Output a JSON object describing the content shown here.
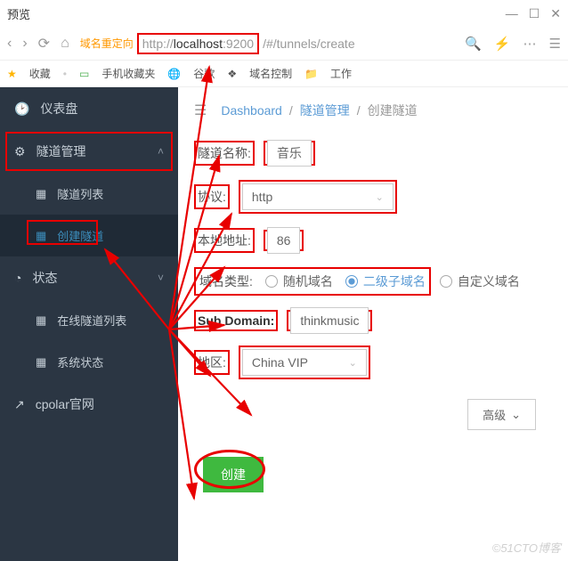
{
  "window": {
    "title": "预览"
  },
  "browser": {
    "redirect_label": "域名重定向",
    "url_proto": "http://",
    "url_domain": "localhost",
    "url_port": ":9200",
    "url_suffix": "/#/tunnels/create"
  },
  "bookmarks": {
    "favorites": "收藏",
    "mobile": "手机收藏夹",
    "google": "谷歌",
    "domain_control": "域名控制",
    "work": "工作"
  },
  "sidebar": {
    "dashboard": "仪表盘",
    "tunnel_mgmt": "隧道管理",
    "tunnel_list": "隧道列表",
    "create_tunnel": "创建隧道",
    "status": "状态",
    "online_list": "在线隧道列表",
    "system_status": "系统状态",
    "cpolar": "cpolar官网"
  },
  "breadcrumb": {
    "dashboard": "Dashboard",
    "tunnel_mgmt": "隧道管理",
    "create": "创建隧道"
  },
  "form": {
    "tunnel_name_label": "隧道名称:",
    "tunnel_name_value": "音乐",
    "protocol_label": "协议:",
    "protocol_value": "http",
    "local_addr_label": "本地地址:",
    "local_addr_value": "86",
    "domain_type_label": "域名类型:",
    "radio_random": "随机域名",
    "radio_subdomain": "二级子域名",
    "radio_custom": "自定义域名",
    "subdomain_label": "Sub Domain:",
    "subdomain_value": "thinkmusic",
    "region_label": "地区:",
    "region_value": "China VIP",
    "advanced": "高级",
    "create": "创建"
  },
  "watermark": "©51CTO博客"
}
